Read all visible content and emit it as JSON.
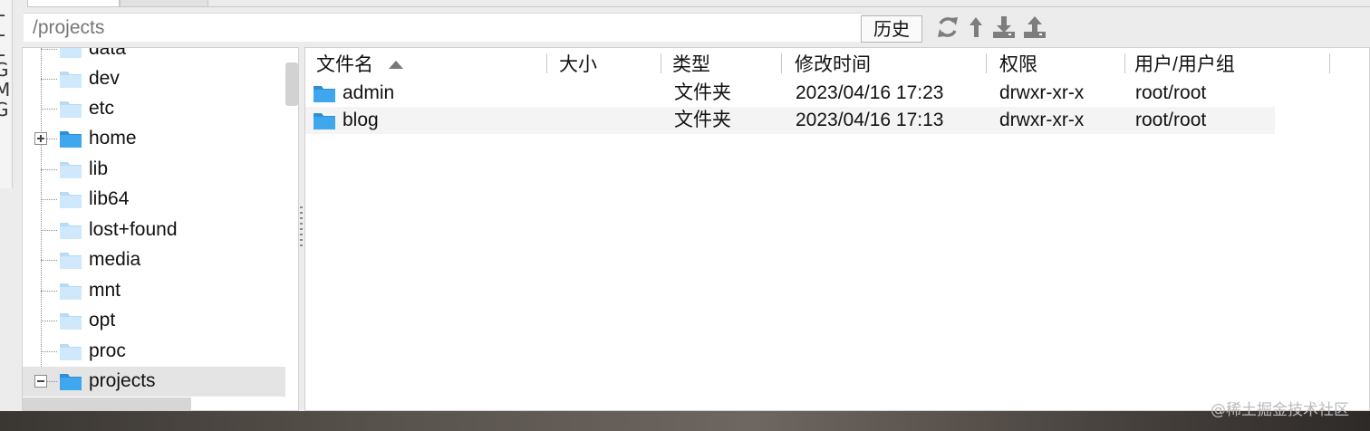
{
  "left_strip": [
    "L",
    "L",
    "L",
    "G",
    "M",
    "G"
  ],
  "path_bar": {
    "path": "/projects"
  },
  "toolbar": {
    "history_label": "历史",
    "icons": [
      "refresh-icon",
      "up-arrow-icon",
      "download-icon",
      "upload-icon"
    ]
  },
  "tree": {
    "items": [
      {
        "label": "data",
        "folder": "light"
      },
      {
        "label": "dev",
        "folder": "light"
      },
      {
        "label": "etc",
        "folder": "light"
      },
      {
        "label": "home",
        "folder": "dark",
        "expander": "plus"
      },
      {
        "label": "lib",
        "folder": "light"
      },
      {
        "label": "lib64",
        "folder": "light"
      },
      {
        "label": "lost+found",
        "folder": "light"
      },
      {
        "label": "media",
        "folder": "light"
      },
      {
        "label": "mnt",
        "folder": "light"
      },
      {
        "label": "opt",
        "folder": "light"
      },
      {
        "label": "proc",
        "folder": "light"
      },
      {
        "label": "projects",
        "folder": "dark",
        "expander": "minus",
        "selected": true
      }
    ]
  },
  "file_table": {
    "columns": [
      "文件名",
      "大小",
      "类型",
      "修改时间",
      "权限",
      "用户/用户组"
    ],
    "rows": [
      {
        "name": "admin",
        "size": "",
        "type": "文件夹",
        "modified": "2023/04/16 17:23",
        "permissions": "drwxr-xr-x",
        "owner": "root/root"
      },
      {
        "name": "blog",
        "size": "",
        "type": "文件夹",
        "modified": "2023/04/16 17:13",
        "permissions": "drwxr-xr-x",
        "owner": "root/root"
      }
    ]
  },
  "watermark": "@稀土掘金技术社区",
  "colors": {
    "folder_light": "#cfe8fb",
    "folder_dark": "#3fa7ee",
    "icon_gray": "#7d7d7d"
  }
}
